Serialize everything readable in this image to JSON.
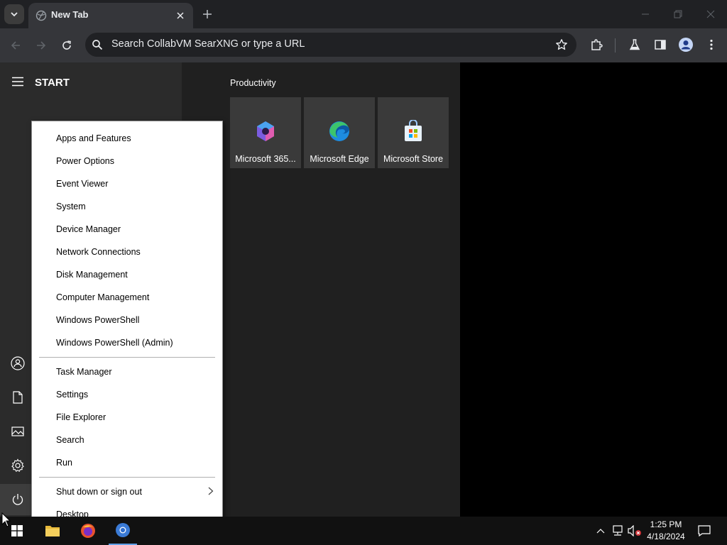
{
  "browser": {
    "tab_title": "New Tab",
    "address_placeholder": "Search CollabVM SearXNG or type a URL"
  },
  "start": {
    "title": "START",
    "group_title": "Productivity",
    "tiles": [
      {
        "label": "Microsoft 365...",
        "icon": "microsoft-365-icon"
      },
      {
        "label": "Microsoft Edge",
        "icon": "edge-icon"
      },
      {
        "label": "Microsoft Store",
        "icon": "store-icon"
      }
    ],
    "rail": [
      "user-icon",
      "document-icon",
      "pictures-icon",
      "settings-icon",
      "power-icon"
    ]
  },
  "context_menu": {
    "items": [
      "Apps and Features",
      "Power Options",
      "Event Viewer",
      "System",
      "Device Manager",
      "Network Connections",
      "Disk Management",
      "Computer Management",
      "Windows PowerShell",
      "Windows PowerShell (Admin)",
      "Task Manager",
      "Settings",
      "File Explorer",
      "Search",
      "Run",
      "Shut down or sign out",
      "Desktop"
    ]
  },
  "taskbar": {
    "time": "1:25 PM",
    "date": "4/18/2024",
    "apps": [
      "file-explorer-icon",
      "firefox-icon",
      "chrome-icon"
    ]
  },
  "colors": {
    "chrome_dark": "#202124",
    "chrome_toolbar": "#35363a",
    "start_left": "#2b2b2b",
    "start_panel": "#202020",
    "tile": "#3a3a3a",
    "taskbar": "#111111"
  }
}
